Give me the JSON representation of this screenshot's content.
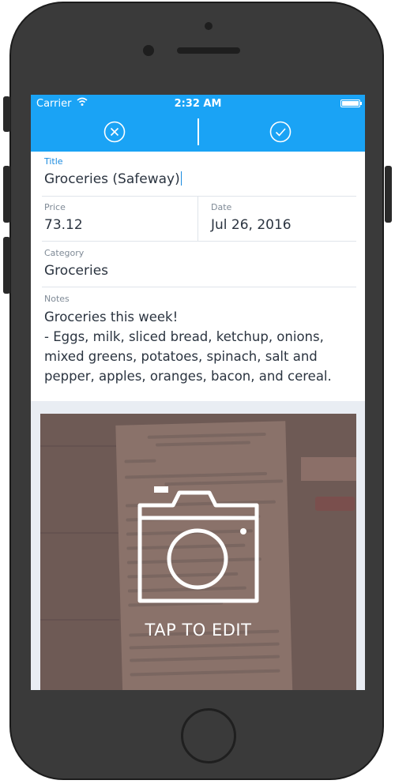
{
  "status_bar": {
    "carrier": "Carrier",
    "time": "2:32 AM",
    "battery_level": 1.0
  },
  "nav_bar": {
    "cancel_icon": "close-circle-icon",
    "confirm_icon": "checkmark-circle-icon",
    "color": "#1aa3f5"
  },
  "form": {
    "title": {
      "label": "Title",
      "value": "Groceries (Safeway)"
    },
    "price": {
      "label": "Price",
      "value": "73.12"
    },
    "date": {
      "label": "Date",
      "value": "Jul 26, 2016"
    },
    "category": {
      "label": "Category",
      "value": "Groceries"
    },
    "notes": {
      "label": "Notes",
      "lines": [
        "Groceries this week!",
        "- Eggs, milk, sliced bread, ketchup, onions,",
        "mixed greens, potatoes, spinach, salt and",
        "pepper, apples, oranges, bacon, and cereal."
      ]
    }
  },
  "photo": {
    "icon": "camera-icon",
    "caption": "TAP TO EDIT"
  }
}
